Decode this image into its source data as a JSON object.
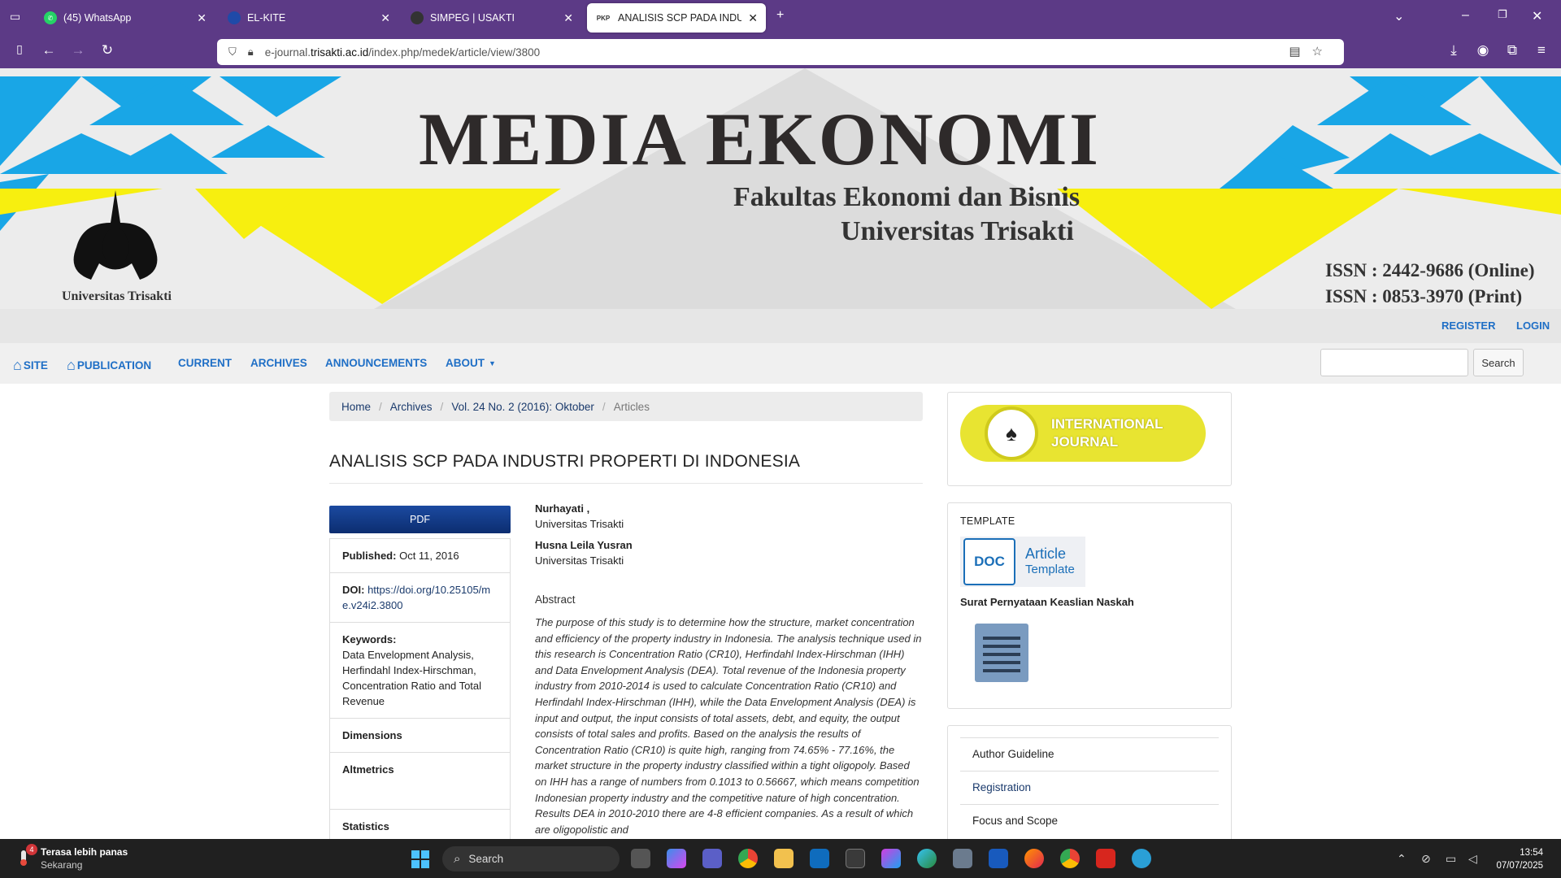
{
  "browser": {
    "tabs": [
      {
        "label": "(45) WhatsApp",
        "icon": "whatsapp-icon",
        "color": "#25d366"
      },
      {
        "label": "EL-KITE",
        "icon": "elkite-icon",
        "color": "#1f4aa8"
      },
      {
        "label": "SIMPEG | USAKTI",
        "icon": "usakti-icon",
        "color": "#333333"
      },
      {
        "label": "ANALISIS SCP PADA INDUSTRI",
        "icon": "pkp-icon",
        "color": "#ffffff",
        "favicon_text": "PKP"
      }
    ],
    "url_prefix": "e-journal.",
    "url_host": "trisakti.ac.id",
    "url_path": "/index.php/medek/article/view/3800"
  },
  "banner": {
    "title": "MEDIA EKONOMI",
    "line1": "Fakultas Ekonomi dan Bisnis",
    "line2": "Universitas Trisakti",
    "issn_online": "ISSN : 2442-9686 (Online)",
    "issn_print": "ISSN : 0853-3970 (Print)",
    "logo_caption": "Universitas Trisakti"
  },
  "userbar": {
    "register": "REGISTER",
    "login": "LOGIN"
  },
  "menu": {
    "site": "SITE",
    "publication": "PUBLICATION",
    "current": "CURRENT",
    "archives": "ARCHIVES",
    "announcements": "ANNOUNCEMENTS",
    "about": "ABOUT",
    "search_button": "Search"
  },
  "breadcrumb": [
    "Home",
    "Archives",
    "Vol. 24 No. 2 (2016): Oktober",
    "Articles"
  ],
  "article": {
    "title": "ANALISIS SCP PADA INDUSTRI PROPERTI DI INDONESIA",
    "pdf_label": "PDF",
    "published_label": "Published:",
    "published_value": "Oct 11, 2016",
    "doi_label": "DOI:",
    "doi_value": "https://doi.org/10.25105/me.v24i2.3800",
    "keywords_label": "Keywords:",
    "keywords_value": "Data Envelopment Analysis, Herfindahl Index-Hirschman, Concentration Ratio and Total Revenue",
    "dimensions": "Dimensions",
    "altmetrics": "Altmetrics",
    "statistics": "Statistics",
    "authors": [
      {
        "name": "Nurhayati ,",
        "affiliation": "Universitas Trisakti"
      },
      {
        "name": "Husna Leila Yusran",
        "affiliation": "Universitas Trisakti"
      }
    ],
    "abstract_heading": "Abstract",
    "abstract": "The purpose of this study is to determine how the structure, market concentration and efficiency of the property industry in Indonesia. The analysis technique used in this research is Concentration Ratio (CR10), Herfindahl Index-Hirschman (IHH) and Data Envelopment Analysis (DEA). Total revenue of the Indonesia property industry from 2010-2014 is used to calculate Concentration Ratio (CR10) and Herfindahl Index-Hirschman (IHH), while the Data Envelopment Analysis (DEA) is input and output, the input consists of total assets, debt, and equity, the output consists of total sales and profits. Based on the analysis the results of Concentration Ratio (CR10) is quite high, ranging from 74.65% - 77.16%, the market structure in the property industry classified within a tight oligopoly. Based on IHH has a range of numbers from 0.1013 to 0.56667, which means competition Indonesian property industry and the competitive nature of high concentration. Results DEA in 2010-2010 there are 4-8 efficient companies. As a result of which are oligopolistic and"
  },
  "sidebar": {
    "intl_line1": "INTERNATIONAL",
    "intl_line2": "JOURNAL",
    "template_heading": "TEMPLATE",
    "doc_badge": "DOC",
    "doc_label1": "Article",
    "doc_label2": "Template",
    "surat": "Surat Pernyataan Keaslian Naskah",
    "nav": [
      "Author Guideline",
      "Registration",
      "Focus and Scope"
    ]
  },
  "taskbar": {
    "weather_title": "Terasa lebih panas",
    "weather_sub": "Sekarang",
    "weather_badge": "4",
    "search": "Search",
    "time": "13:54",
    "date": "07/07/2025"
  }
}
